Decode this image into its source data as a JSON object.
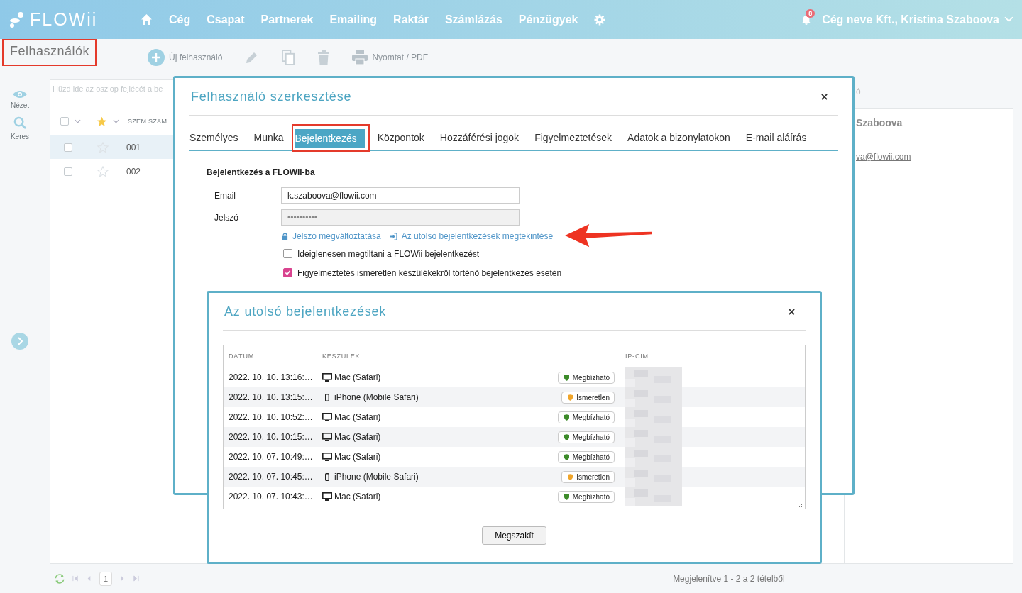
{
  "header": {
    "logo": "FLOWii",
    "nav": [
      {
        "kind": "home"
      },
      {
        "kind": "link",
        "label": "Cég"
      },
      {
        "kind": "link",
        "label": "Csapat"
      },
      {
        "kind": "link",
        "label": "Partnerek"
      },
      {
        "kind": "link",
        "label": "Emailing"
      },
      {
        "kind": "link",
        "label": "Raktár"
      },
      {
        "kind": "link",
        "label": "Számlázás"
      },
      {
        "kind": "link",
        "label": "Pénzügyek"
      },
      {
        "kind": "settings"
      }
    ],
    "notifications": "8",
    "account": "Cég neve Kft., Kristina Szaboova"
  },
  "page": {
    "title": "Felhasználók",
    "highlighted": true
  },
  "toolbar": [
    {
      "kind": "add",
      "label": "Új felhasználó"
    },
    {
      "kind": "edit"
    },
    {
      "kind": "copy"
    },
    {
      "kind": "delete"
    },
    {
      "kind": "print",
      "label": "Nyomtat / PDF"
    }
  ],
  "rail": [
    {
      "kind": "view",
      "label": "Nézet"
    },
    {
      "kind": "search",
      "label": "Keres"
    }
  ],
  "grid": {
    "group_hint": "Hüzd ide az oszlop fejlécét a be",
    "all_checked": false,
    "columns": [
      "SZEM.SZÁM"
    ],
    "rows": [
      {
        "number": "001",
        "selected": true,
        "checked": false,
        "starred": false
      },
      {
        "number": "002",
        "selected": false,
        "checked": false,
        "starred": false
      }
    ]
  },
  "pager": {
    "page": "1",
    "summary": "Megjelenítve 1 - 2 a 2 tételből"
  },
  "detail": {
    "label": "ó",
    "name": "Szaboova",
    "email": "va@flowii.com"
  },
  "edit_dialog": {
    "title": "Felhasználó szerkesztése",
    "tabs": [
      {
        "label": "Személyes",
        "selected": false,
        "highlighted": false
      },
      {
        "label": "Munka",
        "selected": false,
        "highlighted": false
      },
      {
        "label": "Bejelentkezés",
        "selected": true,
        "highlighted": true
      },
      {
        "label": "Központok",
        "selected": false,
        "highlighted": false
      },
      {
        "label": "Hozzáférési jogok",
        "selected": false,
        "highlighted": false
      },
      {
        "label": "Figyelmeztetések",
        "selected": false,
        "highlighted": false
      },
      {
        "label": "Adatok a bizonylatokon",
        "selected": false,
        "highlighted": false
      },
      {
        "label": "E-mail aláírás",
        "selected": false,
        "highlighted": false
      }
    ],
    "section": "Bejelentkezés a FLOWii-ba",
    "fields": [
      {
        "label": "Email",
        "value": "k.szaboova@flowii.com",
        "disabled": false
      },
      {
        "label": "Jelszó",
        "value": "••••••••••",
        "disabled": true
      }
    ],
    "links": [
      {
        "kind": "lock",
        "label": "Jelszó megváltoztatása",
        "pointed": false
      },
      {
        "kind": "login",
        "label": "Az utolsó bejelentkezések megtekintése",
        "pointed": true
      }
    ],
    "checkboxes": [
      {
        "label": "Ideiglenesen megtiltani a FLOWii bejelentkezést",
        "checked": false
      },
      {
        "label": "Figyelmeztetés ismeretlen készülékekről történő bejelentkezés esetén",
        "checked": true
      }
    ]
  },
  "logins_dialog": {
    "title": "Az utolsó bejelentkezések",
    "columns": [
      "DÁTUM",
      "KÉSZÜLÉK",
      "IP-CÍM"
    ],
    "rows": [
      {
        "date": "2022. 10. 10. 13:16:…",
        "device": "Mac (Safari)",
        "kind": "desktop",
        "color": "#3d8b2a",
        "trust_label": "Megbízható"
      },
      {
        "date": "2022. 10. 10. 13:15:…",
        "device": "iPhone (Mobile Safari)",
        "kind": "phone",
        "color": "#f0a52a",
        "trust_label": "Ismeretlen"
      },
      {
        "date": "2022. 10. 10. 10:52:…",
        "device": "Mac (Safari)",
        "kind": "desktop",
        "color": "#3d8b2a",
        "trust_label": "Megbízható"
      },
      {
        "date": "2022. 10. 10. 10:15:…",
        "device": "Mac (Safari)",
        "kind": "desktop",
        "color": "#3d8b2a",
        "trust_label": "Megbízható"
      },
      {
        "date": "2022. 10. 07. 10:49:…",
        "device": "Mac (Safari)",
        "kind": "desktop",
        "color": "#3d8b2a",
        "trust_label": "Megbízható"
      },
      {
        "date": "2022. 10. 07. 10:45:…",
        "device": "iPhone (Mobile Safari)",
        "kind": "phone",
        "color": "#f0a52a",
        "trust_label": "Ismeretlen"
      },
      {
        "date": "2022. 10. 07. 10:43:…",
        "device": "Mac (Safari)",
        "kind": "desktop",
        "color": "#3d8b2a",
        "trust_label": "Megbízható"
      }
    ],
    "cancel": "Megszakít"
  }
}
